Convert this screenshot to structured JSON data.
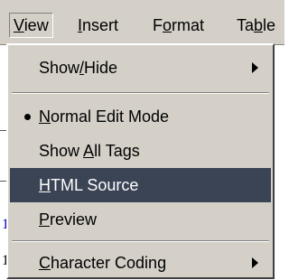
{
  "menubar": {
    "items": [
      {
        "label": "View",
        "mnemonic_index": 0
      },
      {
        "label": "Insert",
        "mnemonic_index": 0
      },
      {
        "label": "Format",
        "mnemonic_index": 1
      },
      {
        "label": "Table",
        "mnemonic_index": 2
      }
    ],
    "active": "View"
  },
  "view_menu": {
    "items": [
      {
        "label": "Show/Hide",
        "mnemonic_index": 4,
        "submenu": true,
        "checked": false,
        "highlighted": false
      },
      {
        "separator": true
      },
      {
        "label": "Normal Edit Mode",
        "mnemonic_index": 0,
        "submenu": false,
        "checked": true,
        "highlighted": false
      },
      {
        "label": "Show All Tags",
        "mnemonic_index": 5,
        "submenu": false,
        "checked": false,
        "highlighted": false
      },
      {
        "label": "HTML Source",
        "mnemonic_index": 0,
        "submenu": false,
        "checked": false,
        "highlighted": true
      },
      {
        "label": "Preview",
        "mnemonic_index": 0,
        "submenu": false,
        "checked": false,
        "highlighted": false
      },
      {
        "separator": true
      },
      {
        "label": "Character Coding",
        "mnemonic_index": 0,
        "submenu": true,
        "checked": false,
        "highlighted": false
      }
    ]
  },
  "background": {
    "left_margin_glyphs": [
      "1",
      "1"
    ]
  },
  "colors": {
    "menu_face": "#d4d0c8",
    "highlight": "#3a4455",
    "highlight_text": "#ffffff",
    "link_digit": "#0000cc"
  }
}
